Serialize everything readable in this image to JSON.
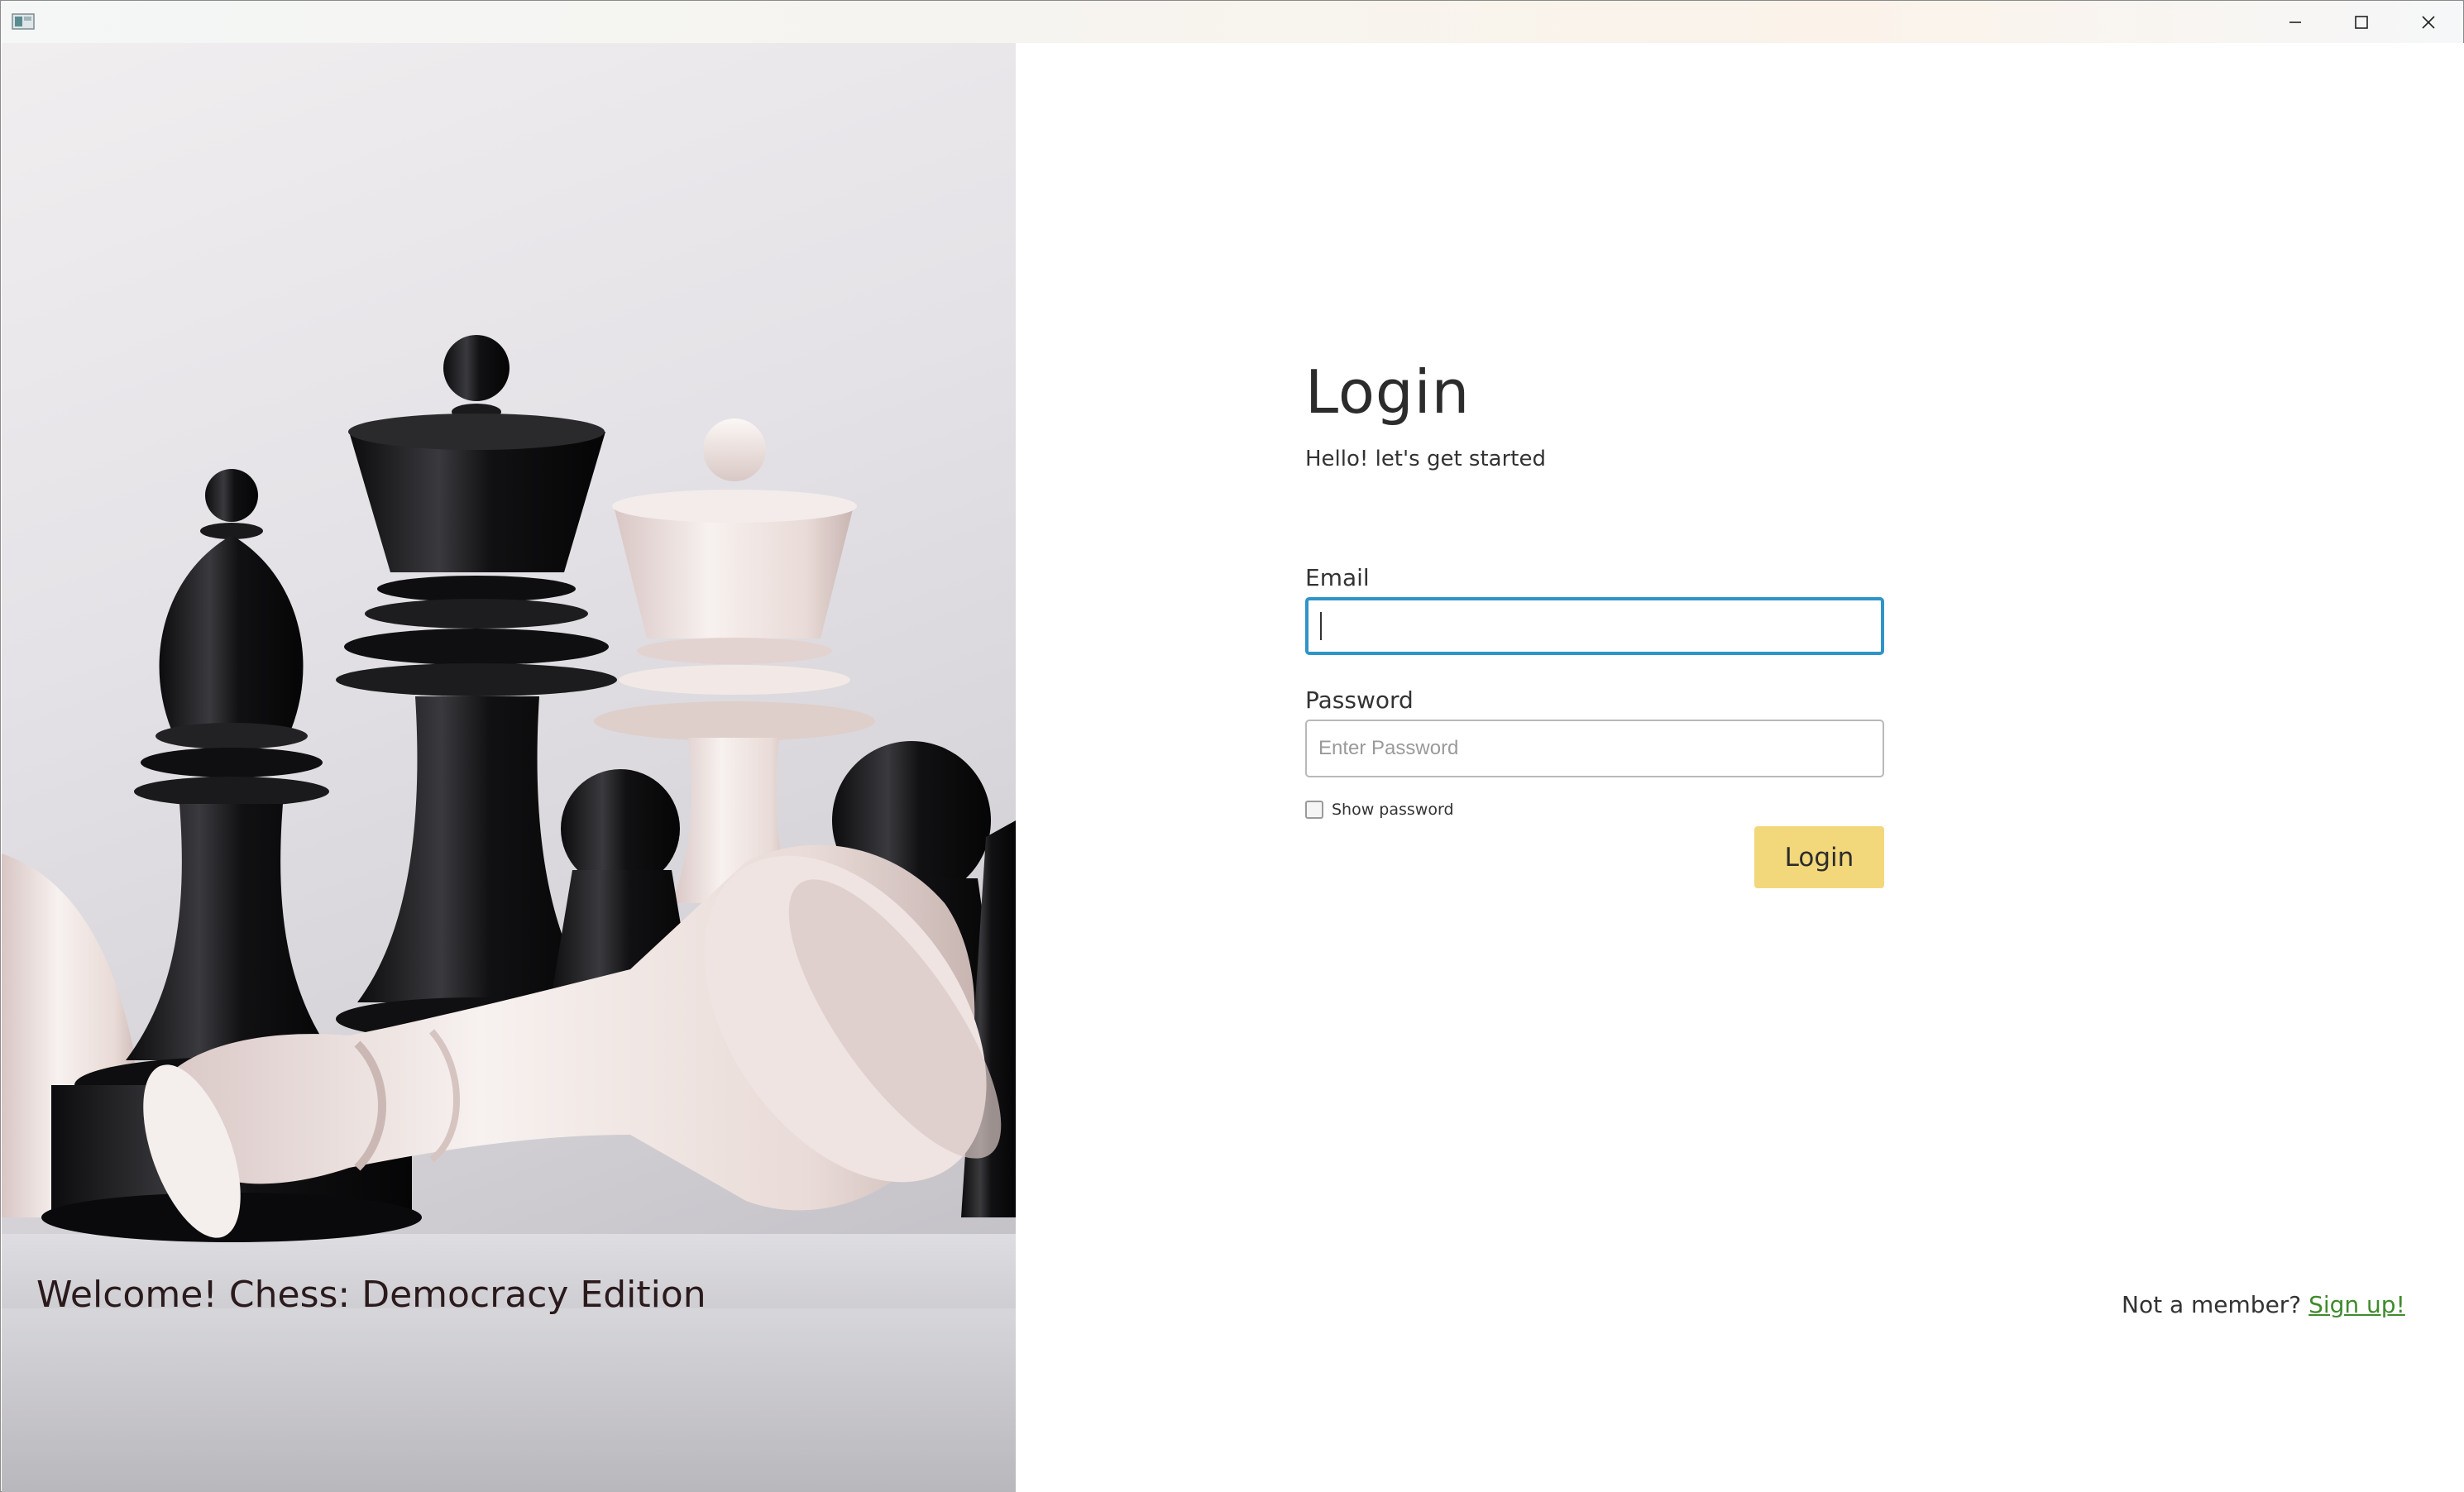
{
  "window": {
    "icons": {
      "app": "app-icon",
      "minimize": "minimize-icon",
      "maximize": "maximize-icon",
      "close": "close-icon"
    }
  },
  "hero": {
    "caption": "Welcome! Chess: Democracy Edition",
    "image": "chess-pieces-illustration"
  },
  "login": {
    "title": "Login",
    "subtitle": "Hello! let's get started",
    "email": {
      "label": "Email",
      "value": "",
      "placeholder": ""
    },
    "password": {
      "label": "Password",
      "value": "",
      "placeholder": "Enter Password"
    },
    "show_password": {
      "label": "Show password",
      "checked": false
    },
    "button_label": "Login",
    "signup_prompt": "Not a member?",
    "signup_link": "Sign up!"
  },
  "colors": {
    "button": "#f3d77b",
    "focus_border": "#2f94c8",
    "link": "#3f8a2c"
  }
}
